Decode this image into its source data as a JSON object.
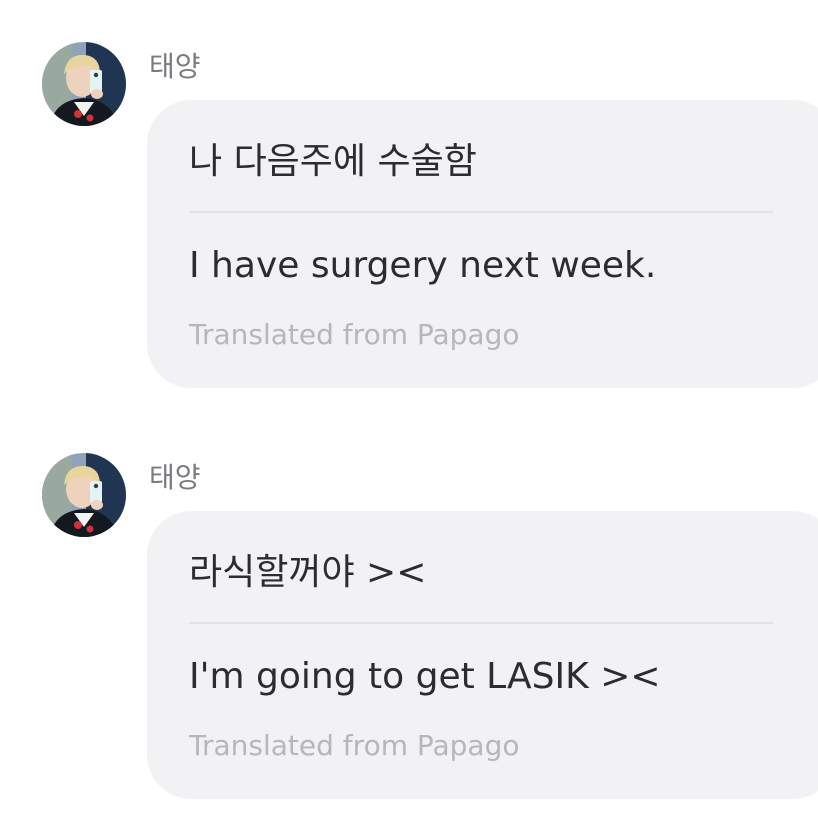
{
  "messages": [
    {
      "sender": "태양",
      "original": "나 다음주에 수술함",
      "translated": "I have surgery next week.",
      "credit": "Translated from Papago"
    },
    {
      "sender": "태양",
      "original": "라식할꺼야 ><",
      "translated": "I'm going to get LASIK ><",
      "credit": "Translated from Papago"
    }
  ],
  "colors": {
    "bubble": "#f2f2f4",
    "text": "#2c2c30",
    "sender": "#7a7a80",
    "credit": "#b6b6bc",
    "divider": "#e3e3e7"
  }
}
